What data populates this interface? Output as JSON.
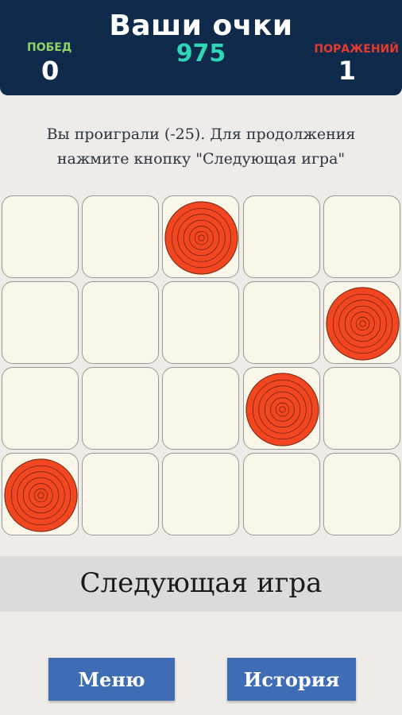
{
  "header": {
    "title": "Ваши очки",
    "score": "975",
    "wins_label": "ПОБЕД",
    "wins_value": "0",
    "losses_label": "ПОРАЖЕНИЙ",
    "losses_value": "1"
  },
  "message": {
    "line1": "Вы проиграли (-25). Для продолжения",
    "line2": "нажмите кнопку \"Следующая игра\""
  },
  "board": {
    "rows": 4,
    "cols": 5,
    "targets": [
      {
        "row": 0,
        "col": 2
      },
      {
        "row": 1,
        "col": 4
      },
      {
        "row": 2,
        "col": 3
      },
      {
        "row": 3,
        "col": 0
      }
    ],
    "target_color": "#f1461f"
  },
  "actions": {
    "next_game": "Следующая игра",
    "menu": "Меню",
    "history": "История"
  },
  "colors": {
    "header_bg": "#0f2a4a",
    "score": "#2fd6b8",
    "wins": "#8fd26a",
    "losses": "#e53a2f",
    "button": "#3e6db5"
  }
}
